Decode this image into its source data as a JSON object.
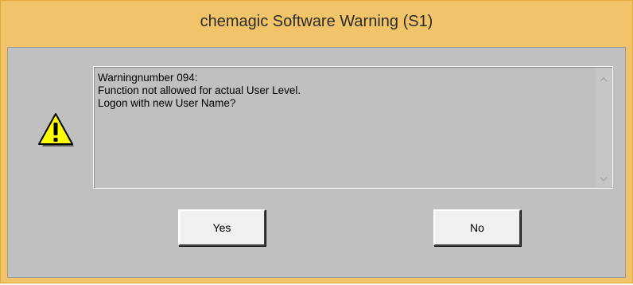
{
  "window": {
    "title": "chemagic Software Warning (S1)"
  },
  "message": {
    "lines": [
      "Warningnumber 094:",
      "Function not allowed for actual User Level.",
      "Logon with new User Name?"
    ]
  },
  "buttons": {
    "yes_label": "Yes",
    "no_label": "No"
  },
  "icons": {
    "warning": "warning-triangle-icon",
    "scroll_up": "chevron-up-icon",
    "scroll_down": "chevron-down-icon"
  },
  "colors": {
    "titlebar": "#f2c46a",
    "client_bg": "#c0c0c0",
    "warning_yellow": "#ffff00",
    "button_face": "#f0f0f0"
  }
}
